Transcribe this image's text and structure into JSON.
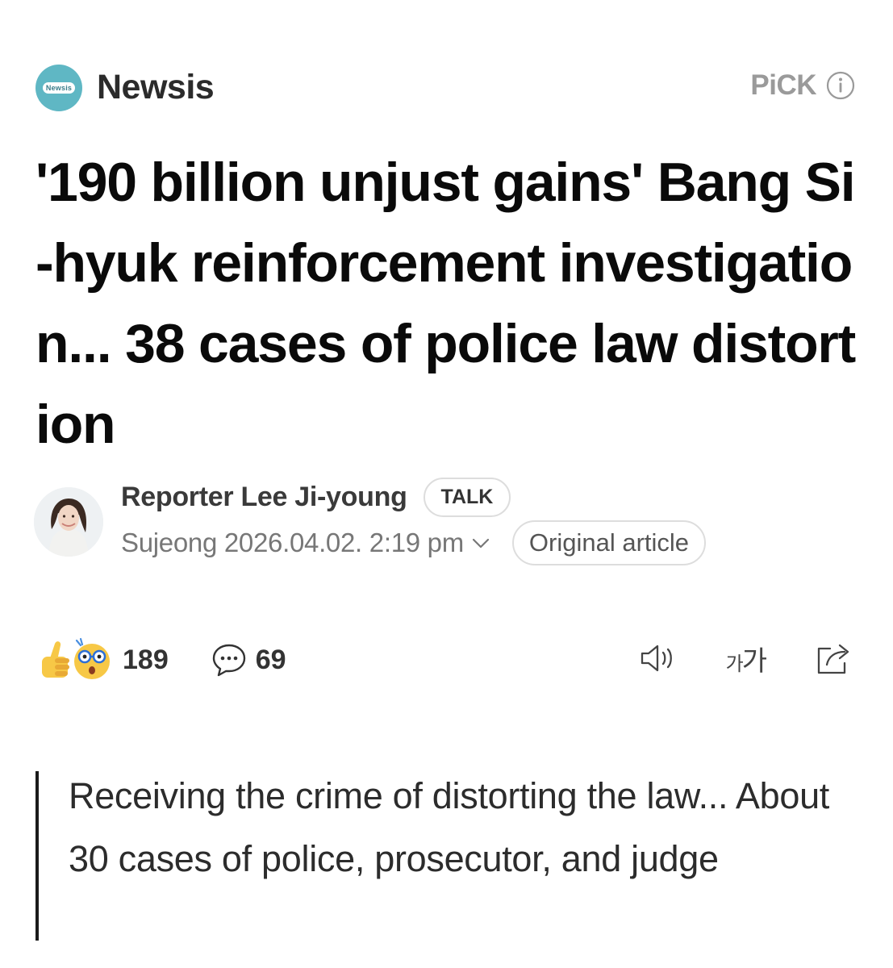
{
  "header": {
    "press_name": "Newsis",
    "press_logo_text": "Newsis",
    "pick_label": "PiCK"
  },
  "article": {
    "headline": "'190 billion unjust gains' Bang Si-hyuk reinforcement investigation... 38 cases of police law distortion",
    "reporter": "Reporter Lee Ji-young",
    "talk_label": "TALK",
    "date_line": "Sujeong 2026.04.02. 2:19 pm",
    "original_label": "Original article"
  },
  "reactions": {
    "reaction_count": "189",
    "comment_count": "69"
  },
  "tools": {
    "font_size_label_small": "가",
    "font_size_label_large": "가"
  },
  "summary": {
    "text": "Receiving the crime of distorting the law... About 30 cases of police, prosecutor, and judge"
  },
  "icons": {
    "info": "info-circle-icon",
    "chevron": "chevron-down-icon",
    "reaction_like": "thumbs-up-emoji-icon",
    "reaction_surprised": "surprised-face-emoji-icon",
    "comment": "comment-bubble-icon",
    "listen": "speaker-icon",
    "font_size": "font-size-icon",
    "share": "share-icon"
  },
  "colors": {
    "logo_teal": "#5fb7c4",
    "headline": "#0a0a0a",
    "muted_text": "#777777",
    "pick_gray": "#9a9a9a"
  }
}
